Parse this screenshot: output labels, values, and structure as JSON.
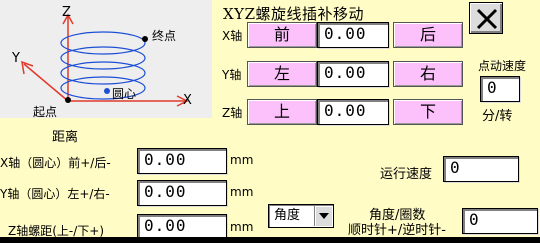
{
  "window": {
    "title": "XYZ螺旋线插补移动"
  },
  "diagram": {
    "axis_z": "Z",
    "axis_y": "Y",
    "axis_x": "X",
    "end_label": "终点",
    "start_label": "起点",
    "center_label": "圆心"
  },
  "jog": {
    "x_label": "X轴",
    "y_label": "Y轴",
    "z_label": "Z轴",
    "x_minus": "前",
    "x_plus": "后",
    "x_value": "0.00",
    "y_minus": "左",
    "y_plus": "右",
    "y_value": "0.00",
    "z_minus": "上",
    "z_plus": "下",
    "z_value": "0.00",
    "speed_label": "点动速度",
    "speed_value": "0",
    "speed_unit": "分/转"
  },
  "params": {
    "distance_heading": "距离",
    "x_center_label": "X轴（圆心）前+/后-",
    "x_center_value": "0.00",
    "y_center_label": "Y轴（圆心）左+/右-",
    "y_center_value": "0.00",
    "z_pitch_label": "Z轴螺距(上-/下+)",
    "z_pitch_value": "0.00",
    "unit": "mm",
    "run_speed_label": "运行速度",
    "run_speed_value": "0",
    "angle_select": "角度",
    "angle_label_1": "角度/圈数",
    "angle_label_2": "顺时针+/逆时针-",
    "angle_value": "0"
  },
  "colors": {
    "background": "#fffcc6",
    "button": "#fcc1fb",
    "spiral": "#1d4fd6",
    "axis": "#e23a2a"
  }
}
